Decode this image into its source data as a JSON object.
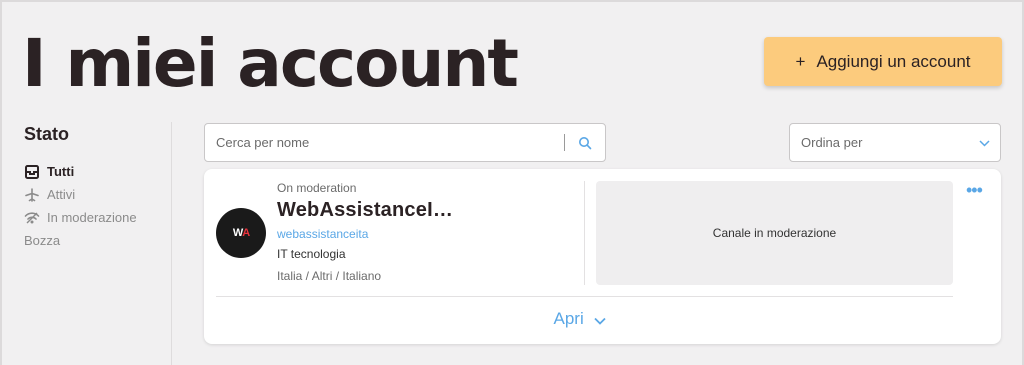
{
  "header": {
    "title": "I miei account",
    "add_button": {
      "plus": "+",
      "label": "Aggiungi un account"
    }
  },
  "sidebar": {
    "title": "Stato",
    "items": [
      {
        "label": "Tutti",
        "icon": "inbox-icon",
        "active": true
      },
      {
        "label": "Attivi",
        "icon": "plane-icon",
        "active": false
      },
      {
        "label": "In moderazione",
        "icon": "wifi-icon",
        "active": false
      },
      {
        "label": "Bozza",
        "icon": "",
        "active": false
      }
    ]
  },
  "toolbar": {
    "search_placeholder": "Cerca per nome",
    "sort_label": "Ordina per"
  },
  "account": {
    "avatar_initials": "W",
    "avatar_initials_accent": "A",
    "status": "On moderation",
    "name": "WebAssistanceI…",
    "handle": "webassistanceita",
    "language_topic": "IT tecnologia",
    "region": "Italia / Altri / Italiano",
    "moderation_text": "Canale in moderazione",
    "more_label": "•••",
    "open_label": "Apri"
  },
  "colors": {
    "accent_blue": "#5aa7e6",
    "button_yellow": "#fccb7d",
    "background": "#f1f0f1"
  }
}
